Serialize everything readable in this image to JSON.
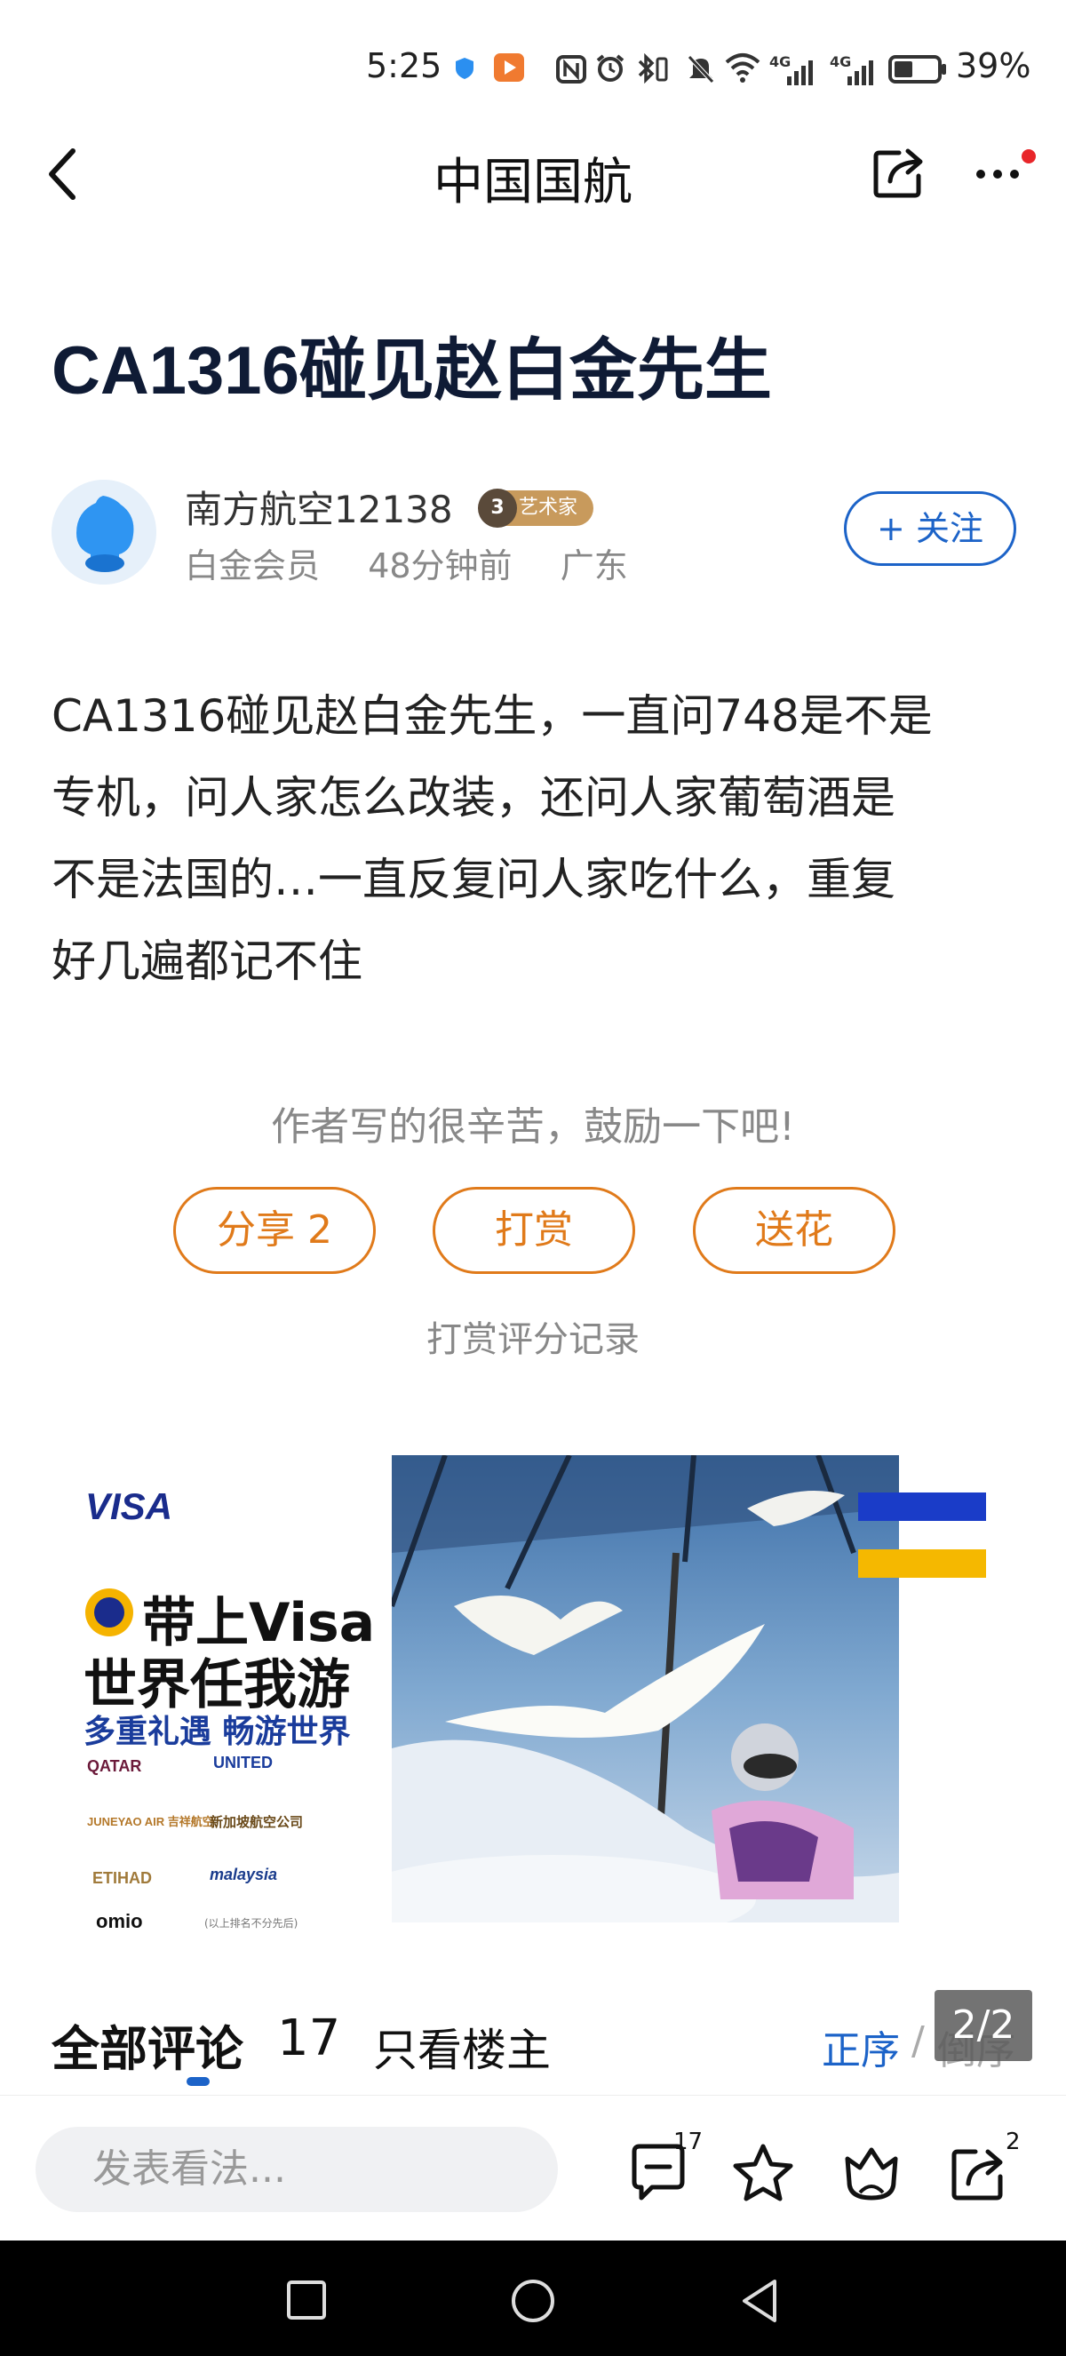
{
  "status_bar": {
    "time": "5:25",
    "battery_percent": "39%",
    "network_1": "4G",
    "network_2": "4G"
  },
  "header": {
    "title": "中国国航",
    "back_icon": "chevron-left-icon",
    "share_icon": "share-icon",
    "more_icon": "more-horizontal-icon"
  },
  "post": {
    "title": "CA1316碰见赵白金先生",
    "body_lines": [
      "CA1316碰见赵白金先生，一直问748是不是",
      "专机，问人家怎么改装，还问人家葡萄酒是",
      "不是法国的…一直反复问人家吃什么，重复",
      "好几遍都记不住"
    ]
  },
  "author": {
    "name": "南方航空12138",
    "badge_level": "3",
    "badge_label": "艺术家",
    "membership": "白金会员",
    "time_ago": "48分钟前",
    "location": "广东",
    "follow_label": "+ 关注"
  },
  "reward": {
    "encourage_text": "作者写的很辛苦，鼓励一下吧!",
    "share_label": "分享 2",
    "reward_label": "打赏",
    "flower_label": "送花",
    "record_label": "打赏评分记录"
  },
  "ad": {
    "brand": "VISA",
    "headline_1": "带上Visa",
    "headline_2": "世界任我游",
    "subheadline": "多重礼遇 畅游世界",
    "partners": [
      "QATAR",
      "UNITED",
      "JUNEYAO AIR 吉祥航空",
      "新加坡航空公司",
      "ETIHAD",
      "malaysia",
      "omio"
    ],
    "disclaimer": "(以上排名不分先后)"
  },
  "comments": {
    "title": "全部评论",
    "count": "17",
    "owner_only_label": "只看楼主",
    "order_asc": "正序",
    "order_sep": "/",
    "order_desc": "倒序",
    "page_indicator": "2/2"
  },
  "bottom_bar": {
    "input_placeholder": "发表看法...",
    "comment_count": "17",
    "share_count": "2"
  },
  "colors": {
    "accent_blue": "#1c63c8",
    "accent_orange": "#e07a1a",
    "title_navy": "#0f1b35"
  }
}
